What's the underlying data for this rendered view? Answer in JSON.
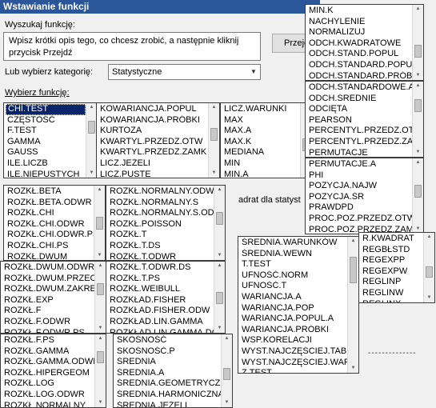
{
  "dialog": {
    "title": "Wstawianie funkcji",
    "search_label": "Wyszukaj funkcję:",
    "description": "Wpisz krótki opis tego, co chcesz zrobić, a następnie kliknij przycisk Przejdź",
    "go_button": "Przejdź",
    "category_label": "Lub wybierz kategorię:",
    "category_value": "Statystyczne",
    "select_label": "Wybierz funkcję:",
    "hint_fragment": "adrat dla statyst",
    "dashes": "--------------"
  },
  "icons": {
    "scroll_up": "triangle-up-icon",
    "scroll_down": "triangle-down-icon",
    "combo_arrow": "chevron-down-icon"
  },
  "lists": [
    {
      "id": "L1",
      "items": [
        "CHI.TEST",
        "CZĘSTOŚĆ",
        "F.TEST",
        "GAMMA",
        "GAUSS",
        "ILE.LICZB",
        "ILE.NIEPUSTYCH"
      ],
      "selected": 0
    },
    {
      "id": "L2",
      "items": [
        "KOWARIANCJA.POPUL",
        "KOWARIANCJA.PRÓBKI",
        "KURTOZA",
        "KWARTYL.PRZEDZ.OTW",
        "KWARTYL.PRZEDZ.ZAMK",
        "LICZ.JEŻELI",
        "LICZ.PUSTE"
      ]
    },
    {
      "id": "L3",
      "items": [
        "LICZ.WARUNKI",
        "MAX",
        "MAX.A",
        "MAX.K",
        "MEDIANA",
        "MIN",
        "MIN.A"
      ]
    },
    {
      "id": "R1",
      "items": [
        "MIN.K",
        "NACHYLENIE",
        "NORMALIZUJ",
        "ODCH.KWADRATOWE",
        "ODCH.STAND.POPUL",
        "ODCH.STANDARD.POPUL.A",
        "ODCH.STANDARD.PRÓBKI"
      ]
    },
    {
      "id": "R2",
      "items": [
        "ODCH.STANDARDOWE.A",
        "ODCH.ŚREDNIE",
        "ODCIĘTA",
        "PEARSON",
        "PERCENTYL.PRZEDZ.OTW",
        "PERCENTYL.PRZEDZ.ZAMK",
        "PERMUTACJE"
      ]
    },
    {
      "id": "R3",
      "items": [
        "PERMUTACJE.A",
        "PHI",
        "POZYCJA.NAJW",
        "POZYCJA.ŚR",
        "PRAWDPD",
        "PROC.POZ.PRZEDZ.OTW",
        "PROC.POZ.PRZEDZ.ZAMK"
      ]
    },
    {
      "id": "M1",
      "items": [
        "ROZKŁ.BETA",
        "ROZKŁ.BETA.ODWR",
        "ROZKŁ.CHI",
        "ROZKŁ.CHI.ODWR",
        "ROZKŁ.CHI.ODWR.PS",
        "ROZKŁ.CHI.PS",
        "ROZKŁ.DWUM"
      ]
    },
    {
      "id": "M2",
      "items": [
        "ROZKŁ.NORMALNY.ODWR",
        "ROZKŁ.NORMALNY.S",
        "ROZKŁ.NORMALNY.S.ODWR",
        "ROZKŁ.POISSON",
        "ROZKŁ.T",
        "ROZKŁ.T.DS",
        "ROZKŁ.T.ODWR"
      ]
    },
    {
      "id": "M3",
      "items": [
        "ROZKŁ.DWUM.ODWR",
        "ROZKŁ.DWUM.PRZEC",
        "ROZKŁ.DWUM.ZAKRES",
        "ROZKŁ.EXP",
        "ROZKŁ.F",
        "ROZKŁ.F.ODWR",
        "ROZKŁ.F.ODWR.PS"
      ]
    },
    {
      "id": "M4",
      "items": [
        "ROZKŁ.T.ODWR.DS",
        "ROZKŁ.T.PS",
        "ROZKŁ.WEIBULL",
        "ROZKŁAD.FISHER",
        "ROZKŁAD.FISHER.ODW",
        "ROZKŁAD.LIN.GAMMA",
        "ROZKŁAD.LIN.GAMMA.DOKŁ"
      ]
    },
    {
      "id": "M5",
      "items": [
        "ŚREDNIA.WARUNKÓW",
        "ŚREDNIA.WEWN",
        "T.TEST",
        "UFNOŚĆ.NORM",
        "UFNOŚĆ.T",
        "WARIANCJA.A",
        "WARIANCJA.POP",
        "WARIANCJA.POPUL.A",
        "WARIANCJA.PRÓBKI",
        "WSP.KORELACJI",
        "WYST.NAJCZĘŚCIEJ.TABL",
        "WYST.NAJCZĘŚCIEJ.WART",
        "Z.TEST"
      ]
    },
    {
      "id": "M6",
      "items": [
        "R.KWADRAT",
        "REGBŁSTD",
        "REGEXPP",
        "REGEXPW",
        "REGLINP",
        "REGLINW",
        "REGLINX"
      ]
    },
    {
      "id": "B1",
      "items": [
        "ROZKŁ.F.PS",
        "ROZKŁ.GAMMA",
        "ROZKŁ.GAMMA.ODWR",
        "ROZKŁ.HIPERGEOM",
        "ROZKŁ.LOG",
        "ROZKŁ.LOG.ODWR",
        "ROZKŁ.NORMALNY"
      ]
    },
    {
      "id": "B2",
      "items": [
        "SKOŚNOŚĆ",
        "SKOŚNOŚĆ.P",
        "ŚREDNIA",
        "ŚREDNIA.A",
        "ŚREDNIA.GEOMETRYCZNA",
        "ŚREDNIA.HARMONICZNA",
        "ŚREDNIA.JEŻELI"
      ]
    }
  ]
}
